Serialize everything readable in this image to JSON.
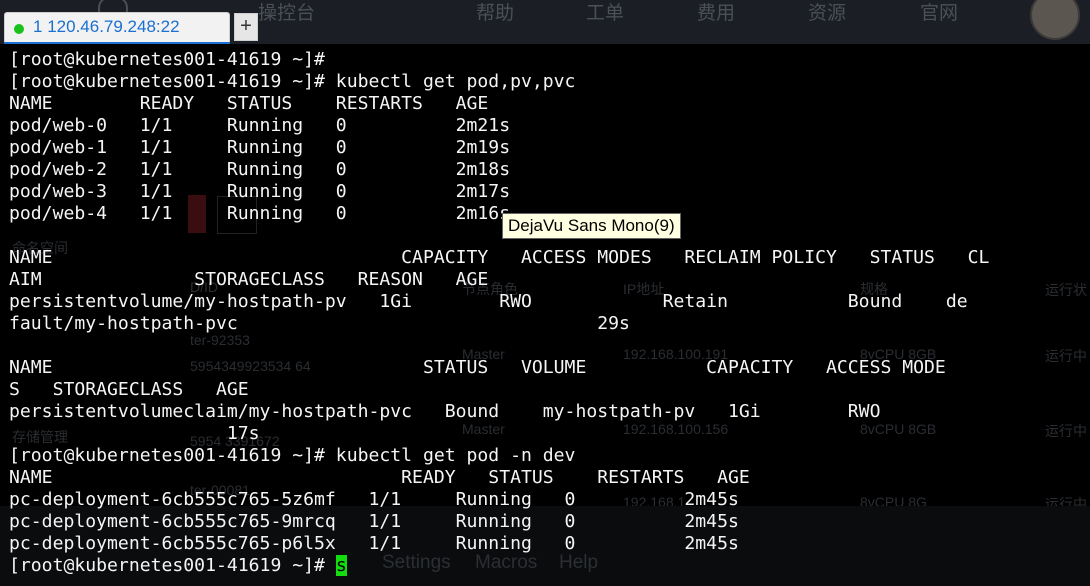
{
  "chrome": {
    "menu": [
      "操控台",
      "帮助",
      "工单",
      "费用",
      "资源",
      "官网"
    ]
  },
  "tab": {
    "number": "1",
    "host": "120.46.79.248:22",
    "add_label": "+"
  },
  "terminal": {
    "lines": [
      "[root@kubernetes001-41619 ~]#",
      "[root@kubernetes001-41619 ~]# kubectl get pod,pv,pvc",
      "NAME        READY   STATUS    RESTARTS   AGE",
      "pod/web-0   1/1     Running   0          2m21s",
      "pod/web-1   1/1     Running   0          2m19s",
      "pod/web-2   1/1     Running   0          2m18s",
      "pod/web-3   1/1     Running   0          2m17s",
      "pod/web-4   1/1     Running   0          2m16s",
      "",
      "NAME                                CAPACITY   ACCESS MODES   RECLAIM POLICY   STATUS   CL",
      "AIM              STORAGECLASS   REASON   AGE",
      "persistentvolume/my-hostpath-pv   1Gi        RWO            Retain           Bound    de",
      "fault/my-hostpath-pvc                                 29s",
      "",
      "NAME                                  STATUS   VOLUME           CAPACITY   ACCESS MODE",
      "S   STORAGECLASS   AGE",
      "persistentvolumeclaim/my-hostpath-pvc   Bound    my-hostpath-pv   1Gi        RWO",
      "                    17s",
      "[root@kubernetes001-41619 ~]# kubectl get pod -n dev",
      "NAME                                READY   STATUS    RESTARTS   AGE",
      "pc-deployment-6cb555c765-5z6mf   1/1     Running   0          2m45s",
      "pc-deployment-6cb555c765-9mrcq   1/1     Running   0          2m45s",
      "pc-deployment-6cb555c765-p6l5x   1/1     Running   0          2m45s"
    ],
    "prompt": "[root@kubernetes001-41619 ~]# ",
    "cursor_char": "s"
  },
  "tooltip": "DejaVu Sans Mono(9)",
  "background_ghost": {
    "namespace": "命名空间",
    "storage": "存储管理",
    "col_id": "D/ID",
    "col_node_role": "节点角色",
    "col_ip": "IP地址",
    "col_spec": "规格",
    "col_status": "运行状",
    "row1_name": "ter-92353",
    "row1_id": "5954349923534 64",
    "row1_role": "Master",
    "row1_ip": "192.168.100.191",
    "row1_spec": "8vCPU 8GB",
    "row1_status": "运行中",
    "row2_id": "5954 3391672",
    "row2_role": "Master",
    "row2_ip": "192.168.100.156",
    "row2_spec": "8vCPU 8GB",
    "row2_status": "运行中",
    "row3_name": "ter-00081",
    "row3_ip": "192.168.1",
    "row3_spec": "8vCPU 8G",
    "row3_status": "运行中",
    "bottom_menu": [
      "Settings",
      "Macros",
      "Help"
    ]
  },
  "colors": {
    "terminal_bg": "#000000",
    "terminal_fg": "#f5f5f5",
    "cursor": "#11dd11",
    "tab_accent": "#1a6fd0",
    "status_dot": "#18c21a",
    "tooltip_bg": "#ffffe1"
  }
}
